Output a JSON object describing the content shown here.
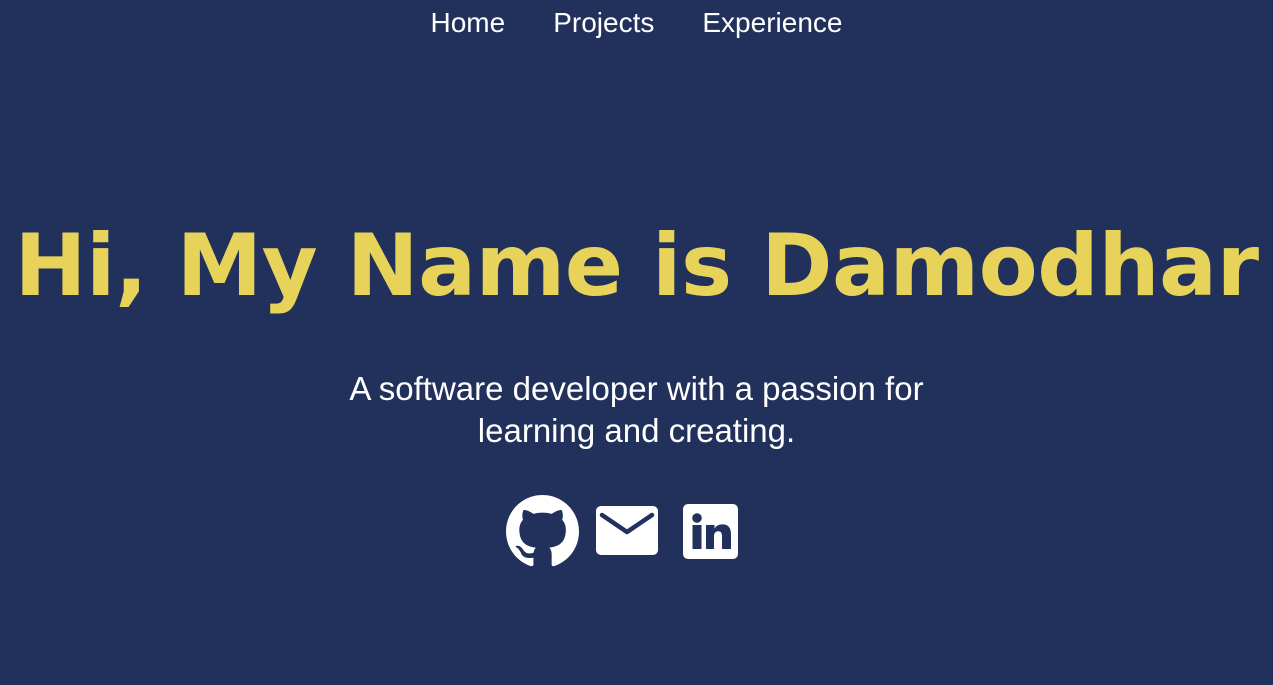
{
  "nav": {
    "items": [
      {
        "label": "Home"
      },
      {
        "label": "Projects"
      },
      {
        "label": "Experience"
      }
    ]
  },
  "hero": {
    "title": "Hi, My Name is Damodhar",
    "subtitle_line1": "A software developer with a passion for",
    "subtitle_line2": "learning and creating."
  },
  "socials": [
    {
      "icon": "github-icon"
    },
    {
      "icon": "mail-icon"
    },
    {
      "icon": "linkedin-icon"
    }
  ],
  "colors": {
    "background": "#22315c",
    "accent": "#e8d35a",
    "text": "#ffffff"
  }
}
